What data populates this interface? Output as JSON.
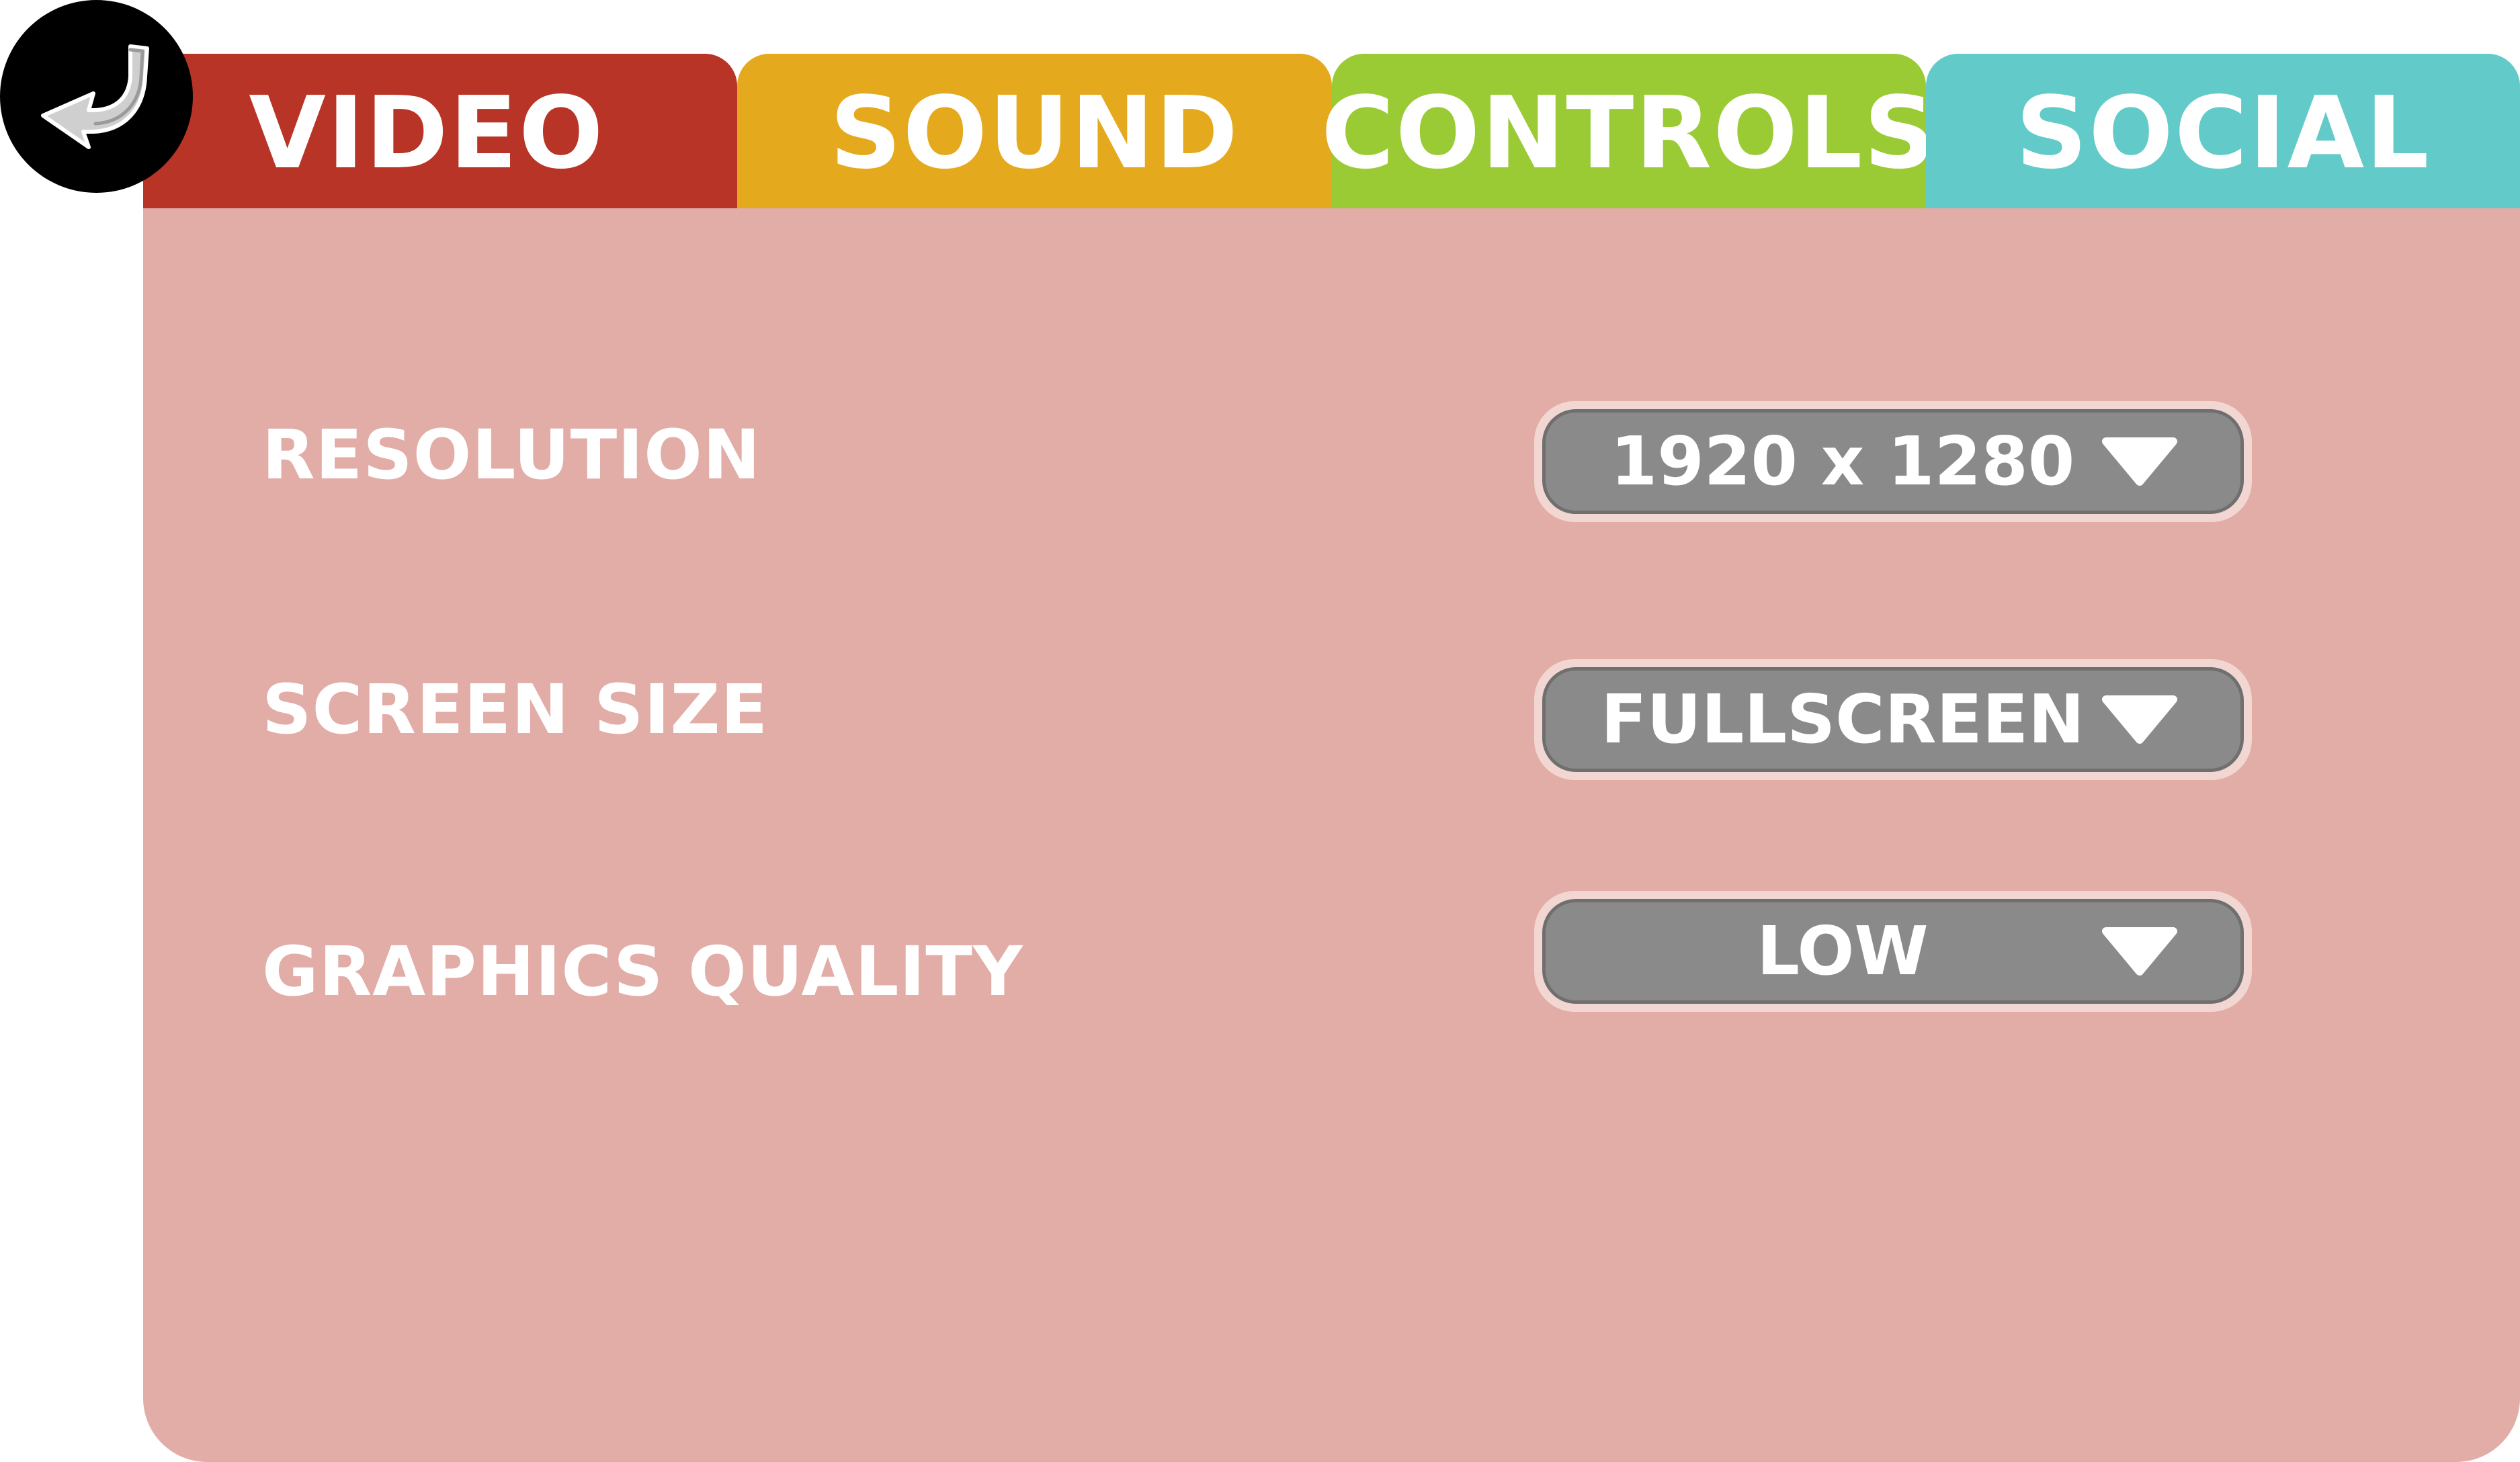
{
  "tabs": {
    "video": {
      "label": "VIDEO",
      "color": "#b83426"
    },
    "sound": {
      "label": "SOUND",
      "color": "#e4a91c"
    },
    "controls": {
      "label": "CONTROLS",
      "color": "#9acb34"
    },
    "social": {
      "label": "SOCIAL",
      "color": "#62cbc9"
    }
  },
  "active_tab": "VIDEO",
  "panel_color": "#e2aca7",
  "back_button": {
    "icon": "back-arrow-icon"
  },
  "settings": {
    "resolution": {
      "label": "RESOLUTION",
      "value": "1920 x 1280",
      "icon": "chevron-down-icon"
    },
    "screen_size": {
      "label": "SCREEN SIZE",
      "value": "FULLSCREEN",
      "icon": "chevron-down-icon"
    },
    "graphics_quality": {
      "label": "GRAPHICS QUALITY",
      "value": "LOW",
      "icon": "chevron-down-icon"
    }
  }
}
